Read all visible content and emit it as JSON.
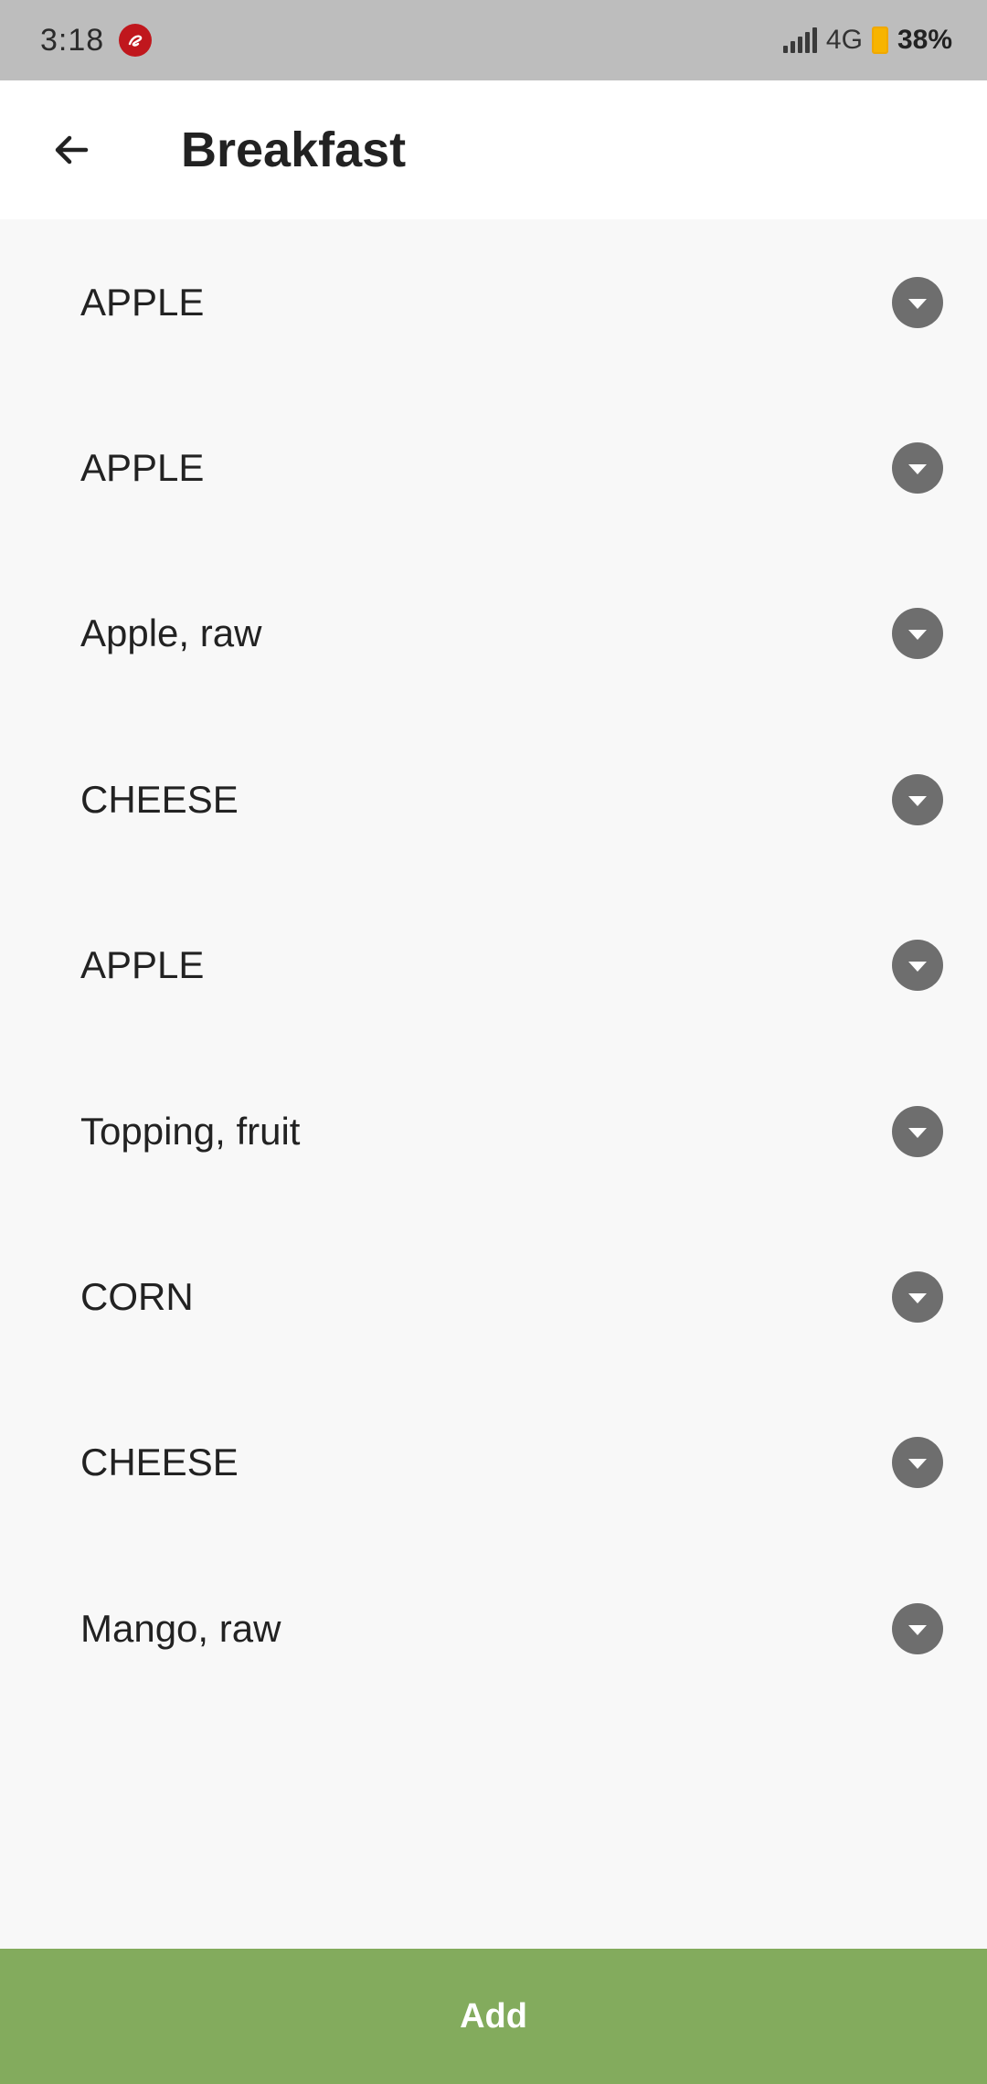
{
  "status_bar": {
    "time": "3:18",
    "network": "4G",
    "battery": "38%"
  },
  "header": {
    "title": "Breakfast"
  },
  "items": [
    {
      "label": "APPLE"
    },
    {
      "label": "APPLE"
    },
    {
      "label": "Apple, raw"
    },
    {
      "label": "CHEESE"
    },
    {
      "label": "APPLE"
    },
    {
      "label": "Topping, fruit"
    },
    {
      "label": "CORN"
    },
    {
      "label": "CHEESE"
    },
    {
      "label": "Mango, raw"
    }
  ],
  "footer": {
    "add_label": "Add"
  },
  "colors": {
    "accent": "#83ab5d",
    "status_bar": "#bdbdbd",
    "expand_icon": "#6e6e6e"
  },
  "icons": {
    "back": "arrow-left-icon",
    "expand": "chevron-down-icon"
  }
}
